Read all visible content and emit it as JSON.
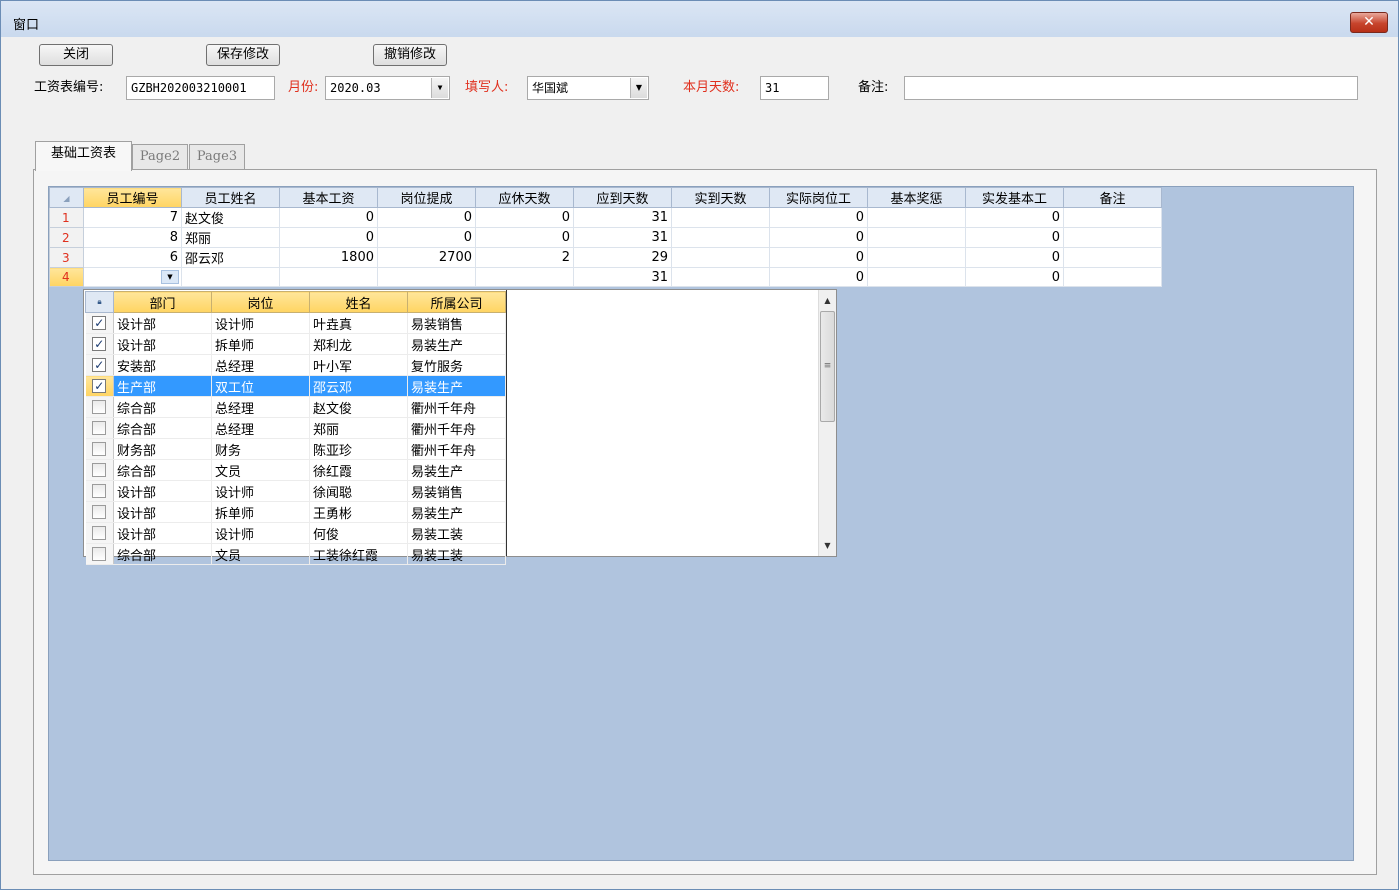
{
  "window": {
    "title": "窗口",
    "close_glyph": "✕"
  },
  "toolbar": {
    "close_label": "关闭",
    "save_label": "保存修改",
    "undo_label": "撤销修改"
  },
  "form": {
    "sheet_no_label": "工资表编号:",
    "sheet_no_value": "GZBH202003210001",
    "month_label": "月份:",
    "month_value": "2020.03",
    "filler_label": "填写人:",
    "filler_value": "华国斌",
    "days_label": "本月天数:",
    "days_value": "31",
    "remark_label": "备注:",
    "remark_value": ""
  },
  "tabs": [
    {
      "label": "基础工资表"
    },
    {
      "label": "Page2"
    },
    {
      "label": "Page3"
    }
  ],
  "main_grid": {
    "columns": [
      "员工编号",
      "员工姓名",
      "基本工资",
      "岗位提成",
      "应休天数",
      "应到天数",
      "实到天数",
      "实际岗位工",
      "基本奖惩",
      "实发基本工",
      "备注"
    ],
    "rows": [
      {
        "rn": "1",
        "cells": [
          "7",
          "赵文俊",
          "0",
          "0",
          "0",
          "31",
          "",
          "0",
          "",
          "0",
          ""
        ]
      },
      {
        "rn": "2",
        "cells": [
          "8",
          "郑丽",
          "0",
          "0",
          "0",
          "31",
          "",
          "0",
          "",
          "0",
          ""
        ]
      },
      {
        "rn": "3",
        "cells": [
          "6",
          "邵云邓",
          "1800",
          "2700",
          "2",
          "29",
          "",
          "0",
          "",
          "0",
          ""
        ]
      },
      {
        "rn": "4",
        "cells": [
          "",
          "",
          "",
          "",
          "",
          "31",
          "",
          "0",
          "",
          "0",
          ""
        ]
      }
    ]
  },
  "dropdown": {
    "columns": [
      "部门",
      "岗位",
      "姓名",
      "所属公司"
    ],
    "check_glyph": "✓",
    "rows": [
      {
        "checked": true,
        "cells": [
          "设计部",
          "设计师",
          "叶垚真",
          "易装销售"
        ]
      },
      {
        "checked": true,
        "cells": [
          "设计部",
          "拆单师",
          "郑利龙",
          "易装生产"
        ]
      },
      {
        "checked": true,
        "cells": [
          "安装部",
          "总经理",
          "叶小军",
          "复竹服务"
        ]
      },
      {
        "checked": true,
        "cells": [
          "生产部",
          "双工位",
          "邵云邓",
          "易装生产"
        ],
        "selected": true
      },
      {
        "checked": false,
        "cells": [
          "综合部",
          "总经理",
          "赵文俊",
          "衢州千年舟"
        ]
      },
      {
        "checked": false,
        "cells": [
          "综合部",
          "总经理",
          "郑丽",
          "衢州千年舟"
        ]
      },
      {
        "checked": false,
        "cells": [
          "财务部",
          "财务",
          "陈亚珍",
          "衢州千年舟"
        ]
      },
      {
        "checked": false,
        "cells": [
          "综合部",
          "文员",
          "徐红霞",
          "易装生产"
        ]
      },
      {
        "checked": false,
        "cells": [
          "设计部",
          "设计师",
          "徐闻聪",
          "易装销售"
        ]
      },
      {
        "checked": false,
        "cells": [
          "设计部",
          "拆单师",
          "王勇彬",
          "易装生产"
        ]
      },
      {
        "checked": false,
        "cells": [
          "设计部",
          "设计师",
          "何俊",
          "易装工装"
        ]
      },
      {
        "checked": false,
        "cells": [
          "综合部",
          "文员",
          "工装徐红霞",
          "易装工装"
        ]
      }
    ]
  },
  "colors": {
    "grid_background": "#b0c4de",
    "selection": "#3399ff",
    "header_highlight": "#ffd462",
    "required_label": "#e0301e"
  }
}
